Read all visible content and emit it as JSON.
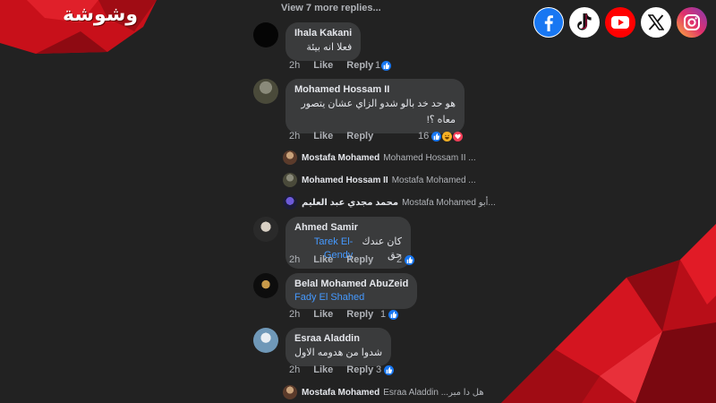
{
  "brand": {
    "logo_text": "وشوشة",
    "accent": "#d9101a"
  },
  "social": [
    "facebook-icon",
    "tiktok-icon",
    "youtube-icon",
    "x-icon",
    "instagram-icon"
  ],
  "view_more": "View 7 more replies...",
  "comments": [
    {
      "author": "Ihala Kakani",
      "text": "فعلا انه بيئة",
      "time": "2h",
      "like": "Like",
      "reply": "Reply",
      "reactions": "1"
    },
    {
      "author": "Mohamed Hossam II",
      "text1": "هو حد خد بالو شدو الزاي  عشان يتصور",
      "text2": "معاه ؟!",
      "time": "2h",
      "like": "Like",
      "reply": "Reply",
      "reactions": "16"
    },
    {
      "author": "Ahmed Samir",
      "text": "كان عندك حق",
      "tag": "Tarek El-Gendy",
      "time": "2h",
      "like": "Like",
      "reply": "Reply",
      "reactions": "2"
    },
    {
      "author": "Belal Mohamed AbuZeid",
      "tag": "Fady El Shahed",
      "time": "2h",
      "like": "Like",
      "reply": "Reply",
      "reactions": "1"
    },
    {
      "author": "Esraa Aladdin",
      "text": "شدوا من هدومه الاول",
      "time": "2h",
      "like": "Like",
      "reply": "Reply",
      "reactions": "3"
    }
  ],
  "replies": [
    {
      "author": "Mostafa Mohamed",
      "preview": "Mohamed Hossam II ..."
    },
    {
      "author": "Mohamed Hossam II",
      "preview": "Mostafa Mohamed ..."
    },
    {
      "author": "محمد مجدي عبد العليم",
      "preview": "Mostafa Mohamed  أبو..."
    },
    {
      "author": "Mostafa Mohamed",
      "preview": "Esraa Aladdin  ...هل دا مبر"
    }
  ]
}
